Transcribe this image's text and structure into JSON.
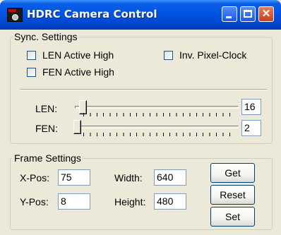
{
  "window": {
    "title": "HDRC Camera Control"
  },
  "sync": {
    "group_label": "Sync. Settings",
    "len_active_high": {
      "label": "LEN Active High",
      "checked": false
    },
    "fen_active_high": {
      "label": "FEN Active High",
      "checked": false
    },
    "inv_pixel_clock": {
      "label": "Inv. Pixel-Clock",
      "checked": false
    },
    "len": {
      "label": "LEN:",
      "value": "16"
    },
    "fen": {
      "label": "FEN:",
      "value": "2"
    }
  },
  "frame": {
    "group_label": "Frame Settings",
    "xpos": {
      "label": "X-Pos:",
      "value": "75"
    },
    "ypos": {
      "label": "Y-Pos:",
      "value": "8"
    },
    "width": {
      "label": "Width:",
      "value": "640"
    },
    "height": {
      "label": "Height:",
      "value": "480"
    },
    "buttons": {
      "get": "Get",
      "reset": "Reset",
      "set": "Set"
    }
  },
  "icons": [
    "app-camera-icon",
    "minimize-icon",
    "maximize-icon",
    "close-icon"
  ]
}
